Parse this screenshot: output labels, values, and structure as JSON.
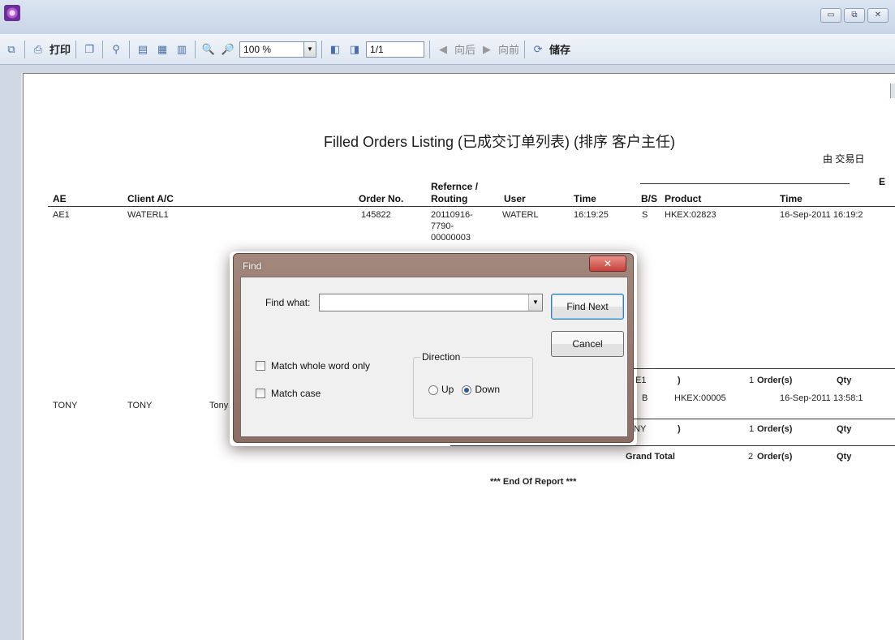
{
  "window": {
    "min_symbol": "▭",
    "max_symbol": "⧉",
    "close_symbol": "✕"
  },
  "toolbar": {
    "print_label": "打印",
    "zoom_value": "100 %",
    "page_value": "1/1",
    "back_label": "向后",
    "forward_label": "向前",
    "save_label": "储存"
  },
  "report": {
    "title": "Filled Orders Listing (已成交订单列表) (排序 客户主任)",
    "subtitle": "由 交易日",
    "corner_letter": "E",
    "headers": {
      "ae": "AE",
      "client": "Client A/C",
      "order_no": "Order No.",
      "reference_line1": "Refernce /",
      "reference_line2": "Routing",
      "user": "User",
      "time": "Time",
      "bs": "B/S",
      "product": "Product",
      "time2": "Time"
    },
    "row1": {
      "ae": "AE1",
      "client": "WATERL1",
      "order_no": "145822",
      "ref1": "20110916-",
      "ref2": "7790-",
      "ref3": "00000003",
      "user": "WATERL",
      "time": "16:19:25",
      "bs": "S",
      "product": "HKEX:02823",
      "time2": "16-Sep-2011 16:19:2"
    },
    "subtotal1": {
      "label": "E1",
      "paren": ")",
      "count": "1",
      "orders_label": "Order(s)",
      "qty_label": "Qty"
    },
    "row2": {
      "ae": "TONY",
      "client": "TONY",
      "name": "Tony",
      "bs": "B",
      "product": "HKEX:00005",
      "time2": "16-Sep-2011 13:58:1"
    },
    "subtotal2": {
      "label": "NY",
      "paren": ")",
      "count": "1",
      "orders_label": "Order(s)",
      "qty_label": "Qty"
    },
    "grand_total": {
      "label": "Grand Total",
      "count": "2",
      "orders_label": "Order(s)",
      "qty_label": "Qty"
    },
    "end_of_report": "*** End Of Report ***"
  },
  "find_dialog": {
    "title": "Find",
    "close_symbol": "✕",
    "find_what_label": "Find what:",
    "find_what_value": "",
    "find_next_label": "Find Next",
    "cancel_label": "Cancel",
    "match_whole_word_label": "Match whole word only",
    "match_case_label": "Match case",
    "direction_label": "Direction",
    "up_label": "Up",
    "down_label": "Down",
    "direction_selected": "Down"
  },
  "colors": {
    "titlebar": "#c8d5e6",
    "dialog_frame": "#8b6e65",
    "close_button": "#c6413a"
  }
}
